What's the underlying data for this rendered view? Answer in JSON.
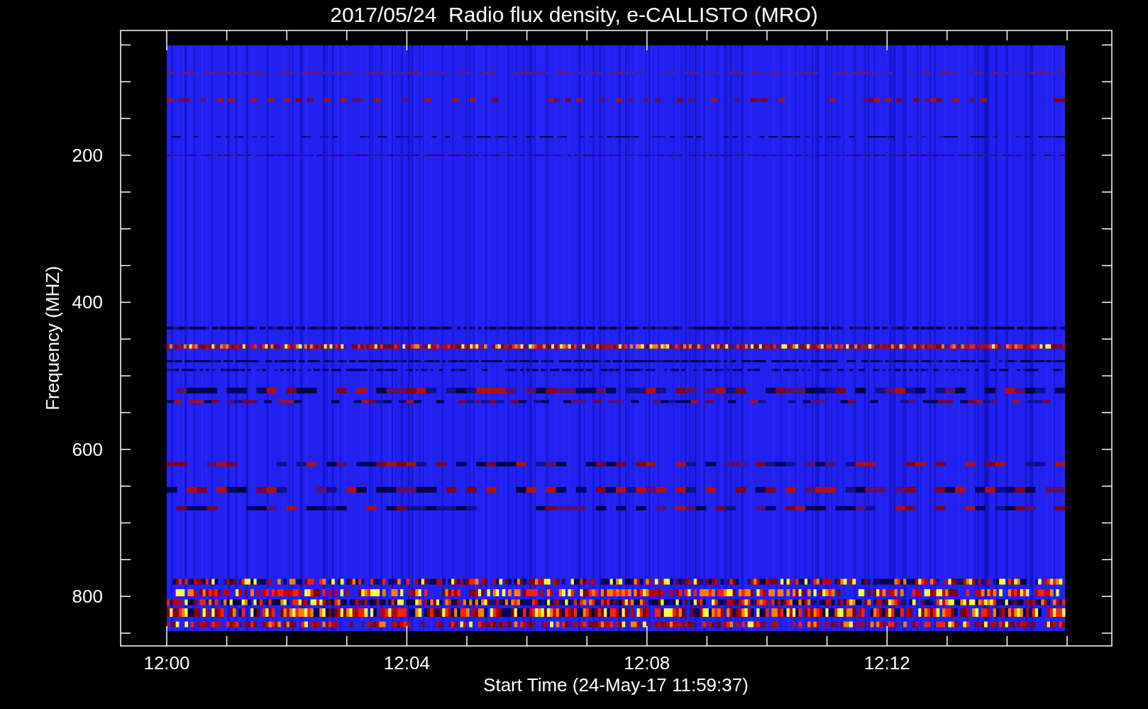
{
  "title": "2017/05/24  Radio flux density, e-CALLISTO (MRO)",
  "y_axis": {
    "label": "Frequency (MHZ)",
    "tick_labels": [
      "200",
      "400",
      "600",
      "800"
    ]
  },
  "x_axis": {
    "label": "Start Time (24-May-17 11:59:37)",
    "tick_labels": [
      "12:00",
      "12:04",
      "12:08",
      "12:12"
    ]
  }
}
